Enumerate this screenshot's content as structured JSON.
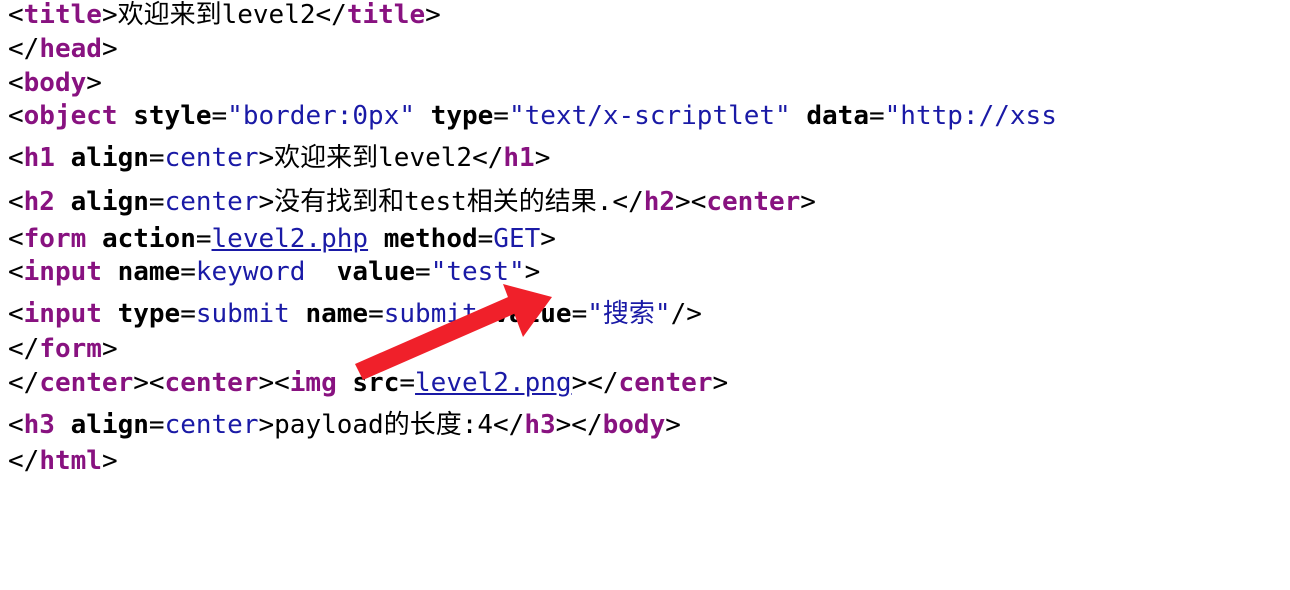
{
  "source": {
    "l1_tag": "title",
    "l1_text": "欢迎来到level2",
    "l1_close": "title",
    "l2_close": "head",
    "l3_tag": "body",
    "l4_tag": "object",
    "l4_attr1": "style",
    "l4_val1": "\"border:0px\"",
    "l4_attr2": "type",
    "l4_val2": "\"text/x-scriptlet\"",
    "l4_attr3": "data",
    "l4_val3": "\"http://xss",
    "l5_tag": "h1",
    "l5_attr": "align",
    "l5_val": "center",
    "l5_text": "欢迎来到level2",
    "l5_close": "h1",
    "l6_tag": "h2",
    "l6_attr": "align",
    "l6_val": "center",
    "l6_text": "没有找到和test相关的结果.",
    "l6_close": "h2",
    "l6_tag2": "center",
    "l7_tag": "form",
    "l7_attr1": "action",
    "l7_link": "level2.php",
    "l7_attr2": "method",
    "l7_val2": "GET",
    "l8_tag": "input",
    "l8_attr1": "name",
    "l8_val1": "keyword",
    "l8_attr2": "value",
    "l8_val2": "\"test\"",
    "l9_tag": "input",
    "l9_attr1": "type",
    "l9_val1": "submit",
    "l9_attr2": "name",
    "l9_val2": "submit",
    "l9_attr3": "value",
    "l9_val3": "\"搜索\"",
    "l10_close": "form",
    "l11_close": "center",
    "l11_tag": "center",
    "l11_tag2": "img",
    "l11_attr": "src",
    "l11_link": "level2.png",
    "l11_close2": "center",
    "l12_tag": "h3",
    "l12_attr": "align",
    "l12_val": "center",
    "l12_text": "payload的长度:4",
    "l12_close": "h3",
    "l12_close2": "body",
    "l13_close": "html"
  },
  "annotation": {
    "arrow_color": "#f0202a",
    "arrow_icon": "red-arrow-icon"
  }
}
